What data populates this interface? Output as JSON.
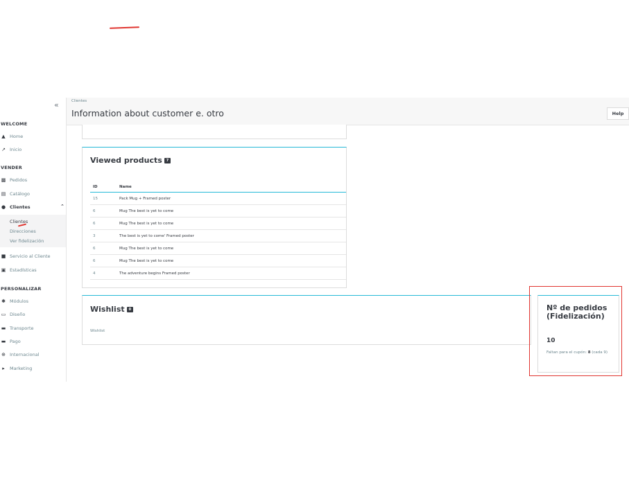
{
  "sidebar": {
    "collapse": "«",
    "sections": {
      "welcome": "WELCOME",
      "vender": "VENDER",
      "personalizar": "PERSONALIZAR"
    },
    "items": {
      "home": "Home",
      "inicio": "Inicio",
      "pedidos": "Pedidos",
      "catalogo": "Catálogo",
      "clientes": "Clientes",
      "servicio": "Servicio al Cliente",
      "estadisticas": "Estadísticas",
      "modulos": "Módulos",
      "diseno": "Diseño",
      "transporte": "Transporte",
      "pago": "Pago",
      "internacional": "Internacional",
      "marketing": "Marketing"
    },
    "sub": {
      "clientes": "Clientes",
      "direcciones": "Direcciones",
      "fidelizacion": "Ver fidelización"
    }
  },
  "header": {
    "breadcrumb": "Clientes",
    "title": "Information about customer e. otro",
    "help": "Help"
  },
  "viewed": {
    "title": "Viewed products",
    "badge": "7",
    "col_id": "ID",
    "col_name": "Name",
    "rows": [
      {
        "id": "15",
        "name": "Pack Mug + Framed poster"
      },
      {
        "id": "6",
        "name": "Mug The best is yet to come"
      },
      {
        "id": "6",
        "name": "Mug The best is yet to come"
      },
      {
        "id": "3",
        "name": "The best is yet to come' Framed poster"
      },
      {
        "id": "6",
        "name": "Mug The best is yet to come"
      },
      {
        "id": "6",
        "name": "Mug The best is yet to come"
      },
      {
        "id": "4",
        "name": "The adventure begins Framed poster"
      }
    ]
  },
  "wishlist": {
    "title": "Wishlist",
    "badge": "0",
    "text": "Wishlist"
  },
  "fidelizacion": {
    "title": "Nº de pedidos (Fidelización)",
    "count": "10",
    "note_prefix": "Faltan para el cupón:",
    "note_value": "8",
    "note_suffix": "(cada 9)"
  }
}
